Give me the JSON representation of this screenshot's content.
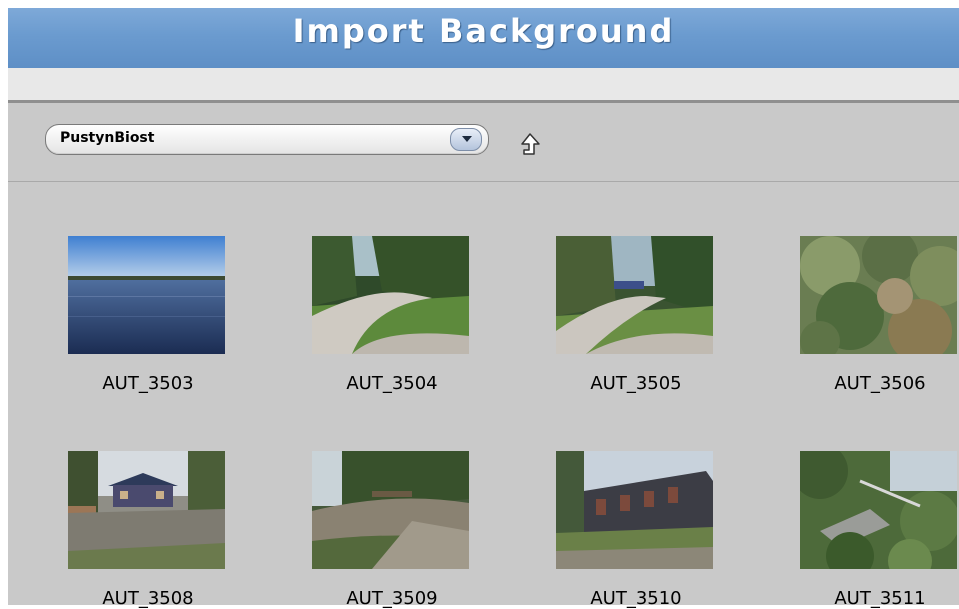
{
  "window": {
    "title": "Import Background"
  },
  "toolbar": {
    "folder_selected": "PustynBiost",
    "up_icon": "arrow-up-folder-icon"
  },
  "thumbnails": [
    {
      "label": "AUT_3503",
      "scene": "lake"
    },
    {
      "label": "AUT_3504",
      "scene": "gravel-path-forest"
    },
    {
      "label": "AUT_3505",
      "scene": "gravel-path-forest"
    },
    {
      "label": "AUT_3506",
      "scene": "bushes"
    },
    {
      "label": "AUT_3508",
      "scene": "house-yard"
    },
    {
      "label": "AUT_3509",
      "scene": "dirt-slope-trees"
    },
    {
      "label": "AUT_3510",
      "scene": "wooden-building"
    },
    {
      "label": "AUT_3511",
      "scene": "overgrown-wreck"
    }
  ]
}
